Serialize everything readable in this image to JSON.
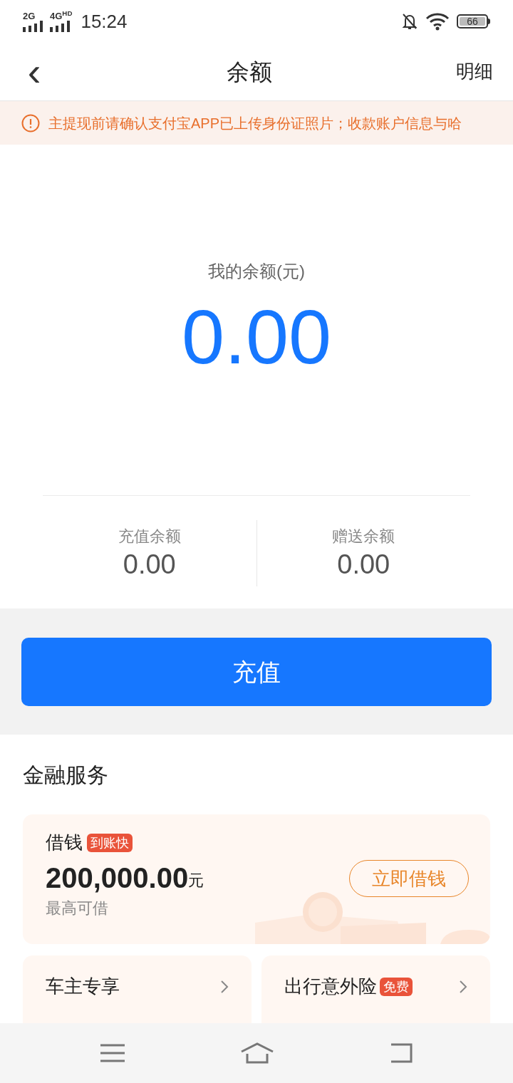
{
  "status_bar": {
    "networks": [
      "2G",
      "4G$^{HD}$"
    ],
    "time": "15:24",
    "battery": "66"
  },
  "header": {
    "back": "‹",
    "title": "余额",
    "action": "明细"
  },
  "notice": {
    "text": "主提现前请确认支付宝APP已上传身份证照片；收款账户信息与哈"
  },
  "balance": {
    "label": "我的余额(元)",
    "amount": "0.00",
    "parts": [
      {
        "label": "充值余额",
        "value": "0.00"
      },
      {
        "label": "赠送余额",
        "value": "0.00"
      }
    ]
  },
  "recharge_button": "充值",
  "finance": {
    "title": "金融服务",
    "loan": {
      "title": "借钱",
      "badge": "到账快",
      "amount": "200,000.00",
      "unit": "元",
      "caption": "最高可借",
      "button": "立即借钱"
    },
    "cards": [
      {
        "title": "车主专享"
      },
      {
        "title": "出行意外险",
        "badge": "免费"
      }
    ]
  }
}
